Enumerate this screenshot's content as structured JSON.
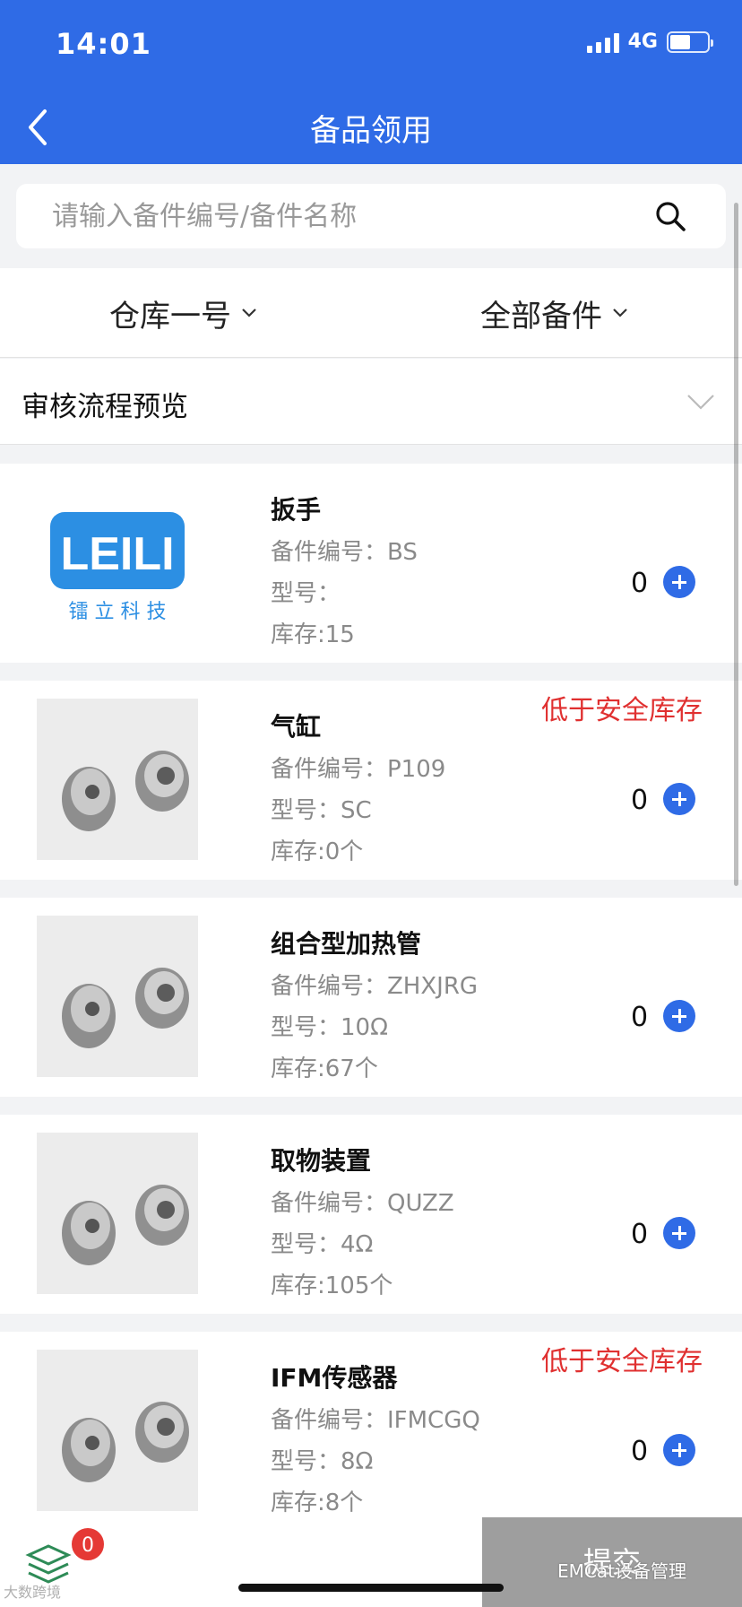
{
  "status": {
    "time": "14:01",
    "network": "4G"
  },
  "header": {
    "title": "备品领用",
    "back_icon": "chevron-left-icon"
  },
  "search": {
    "placeholder": "请输入备件编号/备件名称",
    "value": "",
    "icon": "search-icon"
  },
  "filters": {
    "warehouse": "仓库一号",
    "category": "全部备件"
  },
  "preview": {
    "label": "审核流程预览"
  },
  "items": [
    {
      "name": "扳手",
      "code": "备件编号：BS",
      "model": "型号：",
      "stock": "库存:15",
      "warning": "",
      "qty": "0",
      "image": "leili-logo",
      "logo_text": "LEILI",
      "logo_sub": "镭 立 科 技"
    },
    {
      "name": "气缸",
      "code": "备件编号：P109",
      "model": "型号：SC",
      "stock": "库存:0个",
      "warning": "低于安全库存",
      "qty": "0",
      "image": "metal-part-photo"
    },
    {
      "name": "组合型加热管",
      "code": "备件编号：ZHXJRG",
      "model": "型号：10Ω",
      "stock": "库存:67个",
      "warning": "",
      "qty": "0",
      "image": "metal-part-photo"
    },
    {
      "name": "取物装置",
      "code": "备件编号：QUZZ",
      "model": "型号：4Ω",
      "stock": "库存:105个",
      "warning": "",
      "qty": "0",
      "image": "metal-part-photo"
    },
    {
      "name": "IFM传感器",
      "code": "备件编号：IFMCGQ",
      "model": "型号：8Ω",
      "stock": "库存:8个",
      "warning": "低于安全库存",
      "qty": "0",
      "image": "metal-part-photo"
    }
  ],
  "bottom": {
    "cart_count": "0",
    "submit_label": "提交"
  },
  "watermarks": {
    "left": "大数跨境",
    "right": "EMCat设备管理"
  },
  "colors": {
    "primary": "#2f6be6",
    "warning": "#e03030",
    "submit_disabled": "#9e9e9e"
  }
}
